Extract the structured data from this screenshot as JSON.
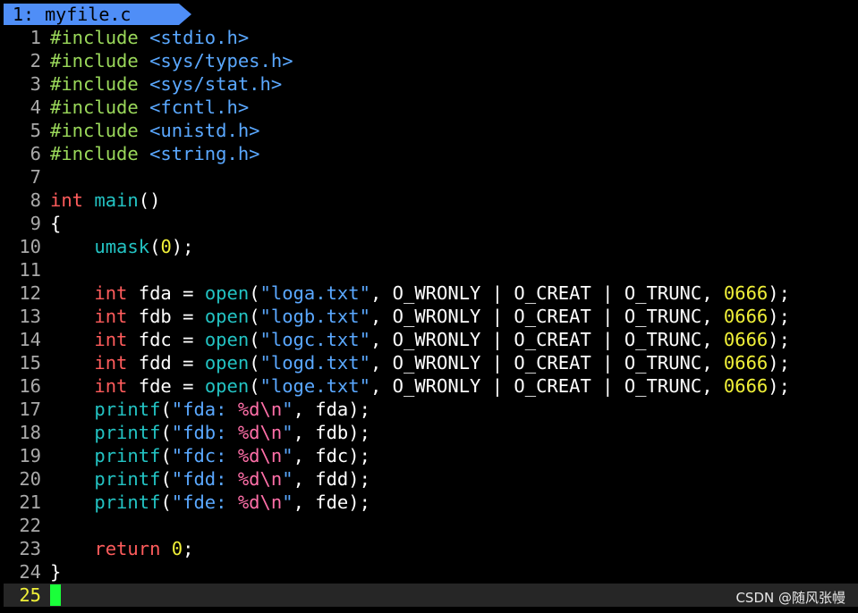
{
  "tab": {
    "label": "1: myfile.c"
  },
  "colors": {
    "background": "#000000",
    "tab_bg": "#4f8ef7",
    "line_number": "#a9a9a9",
    "current_line_number": "#f0f038",
    "preproc": "#9ad85a",
    "header": "#5aa8ff",
    "type": "#ff5c5c",
    "function": "#23c3c3",
    "string": "#5aa8ff",
    "format_specifier": "#ff6fa8",
    "number": "#f0f038",
    "keyword": "#ff5c5c",
    "default_text": "#ffffff",
    "cursor": "#1aff3a"
  },
  "code_lines": [
    {
      "num": "1",
      "tokens": [
        {
          "text": "#include",
          "c": "preproc"
        },
        {
          "text": " ",
          "c": "default_text"
        },
        {
          "text": "<stdio.h>",
          "c": "header"
        }
      ]
    },
    {
      "num": "2",
      "tokens": [
        {
          "text": "#include",
          "c": "preproc"
        },
        {
          "text": " ",
          "c": "default_text"
        },
        {
          "text": "<sys/types.h>",
          "c": "header"
        }
      ]
    },
    {
      "num": "3",
      "tokens": [
        {
          "text": "#include",
          "c": "preproc"
        },
        {
          "text": " ",
          "c": "default_text"
        },
        {
          "text": "<sys/stat.h>",
          "c": "header"
        }
      ]
    },
    {
      "num": "4",
      "tokens": [
        {
          "text": "#include",
          "c": "preproc"
        },
        {
          "text": " ",
          "c": "default_text"
        },
        {
          "text": "<fcntl.h>",
          "c": "header"
        }
      ]
    },
    {
      "num": "5",
      "tokens": [
        {
          "text": "#include",
          "c": "preproc"
        },
        {
          "text": " ",
          "c": "default_text"
        },
        {
          "text": "<unistd.h>",
          "c": "header"
        }
      ]
    },
    {
      "num": "6",
      "tokens": [
        {
          "text": "#include",
          "c": "preproc"
        },
        {
          "text": " ",
          "c": "default_text"
        },
        {
          "text": "<string.h>",
          "c": "header"
        }
      ]
    },
    {
      "num": "7",
      "tokens": []
    },
    {
      "num": "8",
      "tokens": [
        {
          "text": "int",
          "c": "type"
        },
        {
          "text": " ",
          "c": "default_text"
        },
        {
          "text": "main",
          "c": "function"
        },
        {
          "text": "()",
          "c": "default_text"
        }
      ]
    },
    {
      "num": "9",
      "tokens": [
        {
          "text": "{",
          "c": "default_text"
        }
      ]
    },
    {
      "num": "10",
      "tokens": [
        {
          "text": "    ",
          "c": "default_text"
        },
        {
          "text": "umask",
          "c": "function"
        },
        {
          "text": "(",
          "c": "default_text"
        },
        {
          "text": "0",
          "c": "number"
        },
        {
          "text": ");",
          "c": "default_text"
        }
      ]
    },
    {
      "num": "11",
      "tokens": []
    },
    {
      "num": "12",
      "tokens": [
        {
          "text": "    ",
          "c": "default_text"
        },
        {
          "text": "int",
          "c": "type"
        },
        {
          "text": " fda = ",
          "c": "default_text"
        },
        {
          "text": "open",
          "c": "function"
        },
        {
          "text": "(",
          "c": "default_text"
        },
        {
          "text": "\"loga.txt\"",
          "c": "string"
        },
        {
          "text": ", O_WRONLY | O_CREAT | O_TRUNC, ",
          "c": "default_text"
        },
        {
          "text": "0666",
          "c": "number"
        },
        {
          "text": ");",
          "c": "default_text"
        }
      ]
    },
    {
      "num": "13",
      "tokens": [
        {
          "text": "    ",
          "c": "default_text"
        },
        {
          "text": "int",
          "c": "type"
        },
        {
          "text": " fdb = ",
          "c": "default_text"
        },
        {
          "text": "open",
          "c": "function"
        },
        {
          "text": "(",
          "c": "default_text"
        },
        {
          "text": "\"logb.txt\"",
          "c": "string"
        },
        {
          "text": ", O_WRONLY | O_CREAT | O_TRUNC, ",
          "c": "default_text"
        },
        {
          "text": "0666",
          "c": "number"
        },
        {
          "text": ");",
          "c": "default_text"
        }
      ]
    },
    {
      "num": "14",
      "tokens": [
        {
          "text": "    ",
          "c": "default_text"
        },
        {
          "text": "int",
          "c": "type"
        },
        {
          "text": " fdc = ",
          "c": "default_text"
        },
        {
          "text": "open",
          "c": "function"
        },
        {
          "text": "(",
          "c": "default_text"
        },
        {
          "text": "\"logc.txt\"",
          "c": "string"
        },
        {
          "text": ", O_WRONLY | O_CREAT | O_TRUNC, ",
          "c": "default_text"
        },
        {
          "text": "0666",
          "c": "number"
        },
        {
          "text": ");",
          "c": "default_text"
        }
      ]
    },
    {
      "num": "15",
      "tokens": [
        {
          "text": "    ",
          "c": "default_text"
        },
        {
          "text": "int",
          "c": "type"
        },
        {
          "text": " fdd = ",
          "c": "default_text"
        },
        {
          "text": "open",
          "c": "function"
        },
        {
          "text": "(",
          "c": "default_text"
        },
        {
          "text": "\"logd.txt\"",
          "c": "string"
        },
        {
          "text": ", O_WRONLY | O_CREAT | O_TRUNC, ",
          "c": "default_text"
        },
        {
          "text": "0666",
          "c": "number"
        },
        {
          "text": ");",
          "c": "default_text"
        }
      ]
    },
    {
      "num": "16",
      "tokens": [
        {
          "text": "    ",
          "c": "default_text"
        },
        {
          "text": "int",
          "c": "type"
        },
        {
          "text": " fde = ",
          "c": "default_text"
        },
        {
          "text": "open",
          "c": "function"
        },
        {
          "text": "(",
          "c": "default_text"
        },
        {
          "text": "\"loge.txt\"",
          "c": "string"
        },
        {
          "text": ", O_WRONLY | O_CREAT | O_TRUNC, ",
          "c": "default_text"
        },
        {
          "text": "0666",
          "c": "number"
        },
        {
          "text": ");",
          "c": "default_text"
        }
      ]
    },
    {
      "num": "17",
      "tokens": [
        {
          "text": "    ",
          "c": "default_text"
        },
        {
          "text": "printf",
          "c": "function"
        },
        {
          "text": "(",
          "c": "default_text"
        },
        {
          "text": "\"fda: ",
          "c": "string"
        },
        {
          "text": "%d\\n",
          "c": "format_specifier"
        },
        {
          "text": "\"",
          "c": "string"
        },
        {
          "text": ", fda);",
          "c": "default_text"
        }
      ]
    },
    {
      "num": "18",
      "tokens": [
        {
          "text": "    ",
          "c": "default_text"
        },
        {
          "text": "printf",
          "c": "function"
        },
        {
          "text": "(",
          "c": "default_text"
        },
        {
          "text": "\"fdb: ",
          "c": "string"
        },
        {
          "text": "%d\\n",
          "c": "format_specifier"
        },
        {
          "text": "\"",
          "c": "string"
        },
        {
          "text": ", fdb);",
          "c": "default_text"
        }
      ]
    },
    {
      "num": "19",
      "tokens": [
        {
          "text": "    ",
          "c": "default_text"
        },
        {
          "text": "printf",
          "c": "function"
        },
        {
          "text": "(",
          "c": "default_text"
        },
        {
          "text": "\"fdc: ",
          "c": "string"
        },
        {
          "text": "%d\\n",
          "c": "format_specifier"
        },
        {
          "text": "\"",
          "c": "string"
        },
        {
          "text": ", fdc);",
          "c": "default_text"
        }
      ]
    },
    {
      "num": "20",
      "tokens": [
        {
          "text": "    ",
          "c": "default_text"
        },
        {
          "text": "printf",
          "c": "function"
        },
        {
          "text": "(",
          "c": "default_text"
        },
        {
          "text": "\"fdd: ",
          "c": "string"
        },
        {
          "text": "%d\\n",
          "c": "format_specifier"
        },
        {
          "text": "\"",
          "c": "string"
        },
        {
          "text": ", fdd);",
          "c": "default_text"
        }
      ]
    },
    {
      "num": "21",
      "tokens": [
        {
          "text": "    ",
          "c": "default_text"
        },
        {
          "text": "printf",
          "c": "function"
        },
        {
          "text": "(",
          "c": "default_text"
        },
        {
          "text": "\"fde: ",
          "c": "string"
        },
        {
          "text": "%d\\n",
          "c": "format_specifier"
        },
        {
          "text": "\"",
          "c": "string"
        },
        {
          "text": ", fde);",
          "c": "default_text"
        }
      ]
    },
    {
      "num": "22",
      "tokens": []
    },
    {
      "num": "23",
      "tokens": [
        {
          "text": "    ",
          "c": "default_text"
        },
        {
          "text": "return",
          "c": "keyword"
        },
        {
          "text": " ",
          "c": "default_text"
        },
        {
          "text": "0",
          "c": "number"
        },
        {
          "text": ";",
          "c": "default_text"
        }
      ]
    },
    {
      "num": "24",
      "tokens": [
        {
          "text": "}",
          "c": "default_text"
        }
      ]
    },
    {
      "num": "25",
      "tokens": [],
      "current": true
    }
  ],
  "watermark": "CSDN @随风张幔"
}
